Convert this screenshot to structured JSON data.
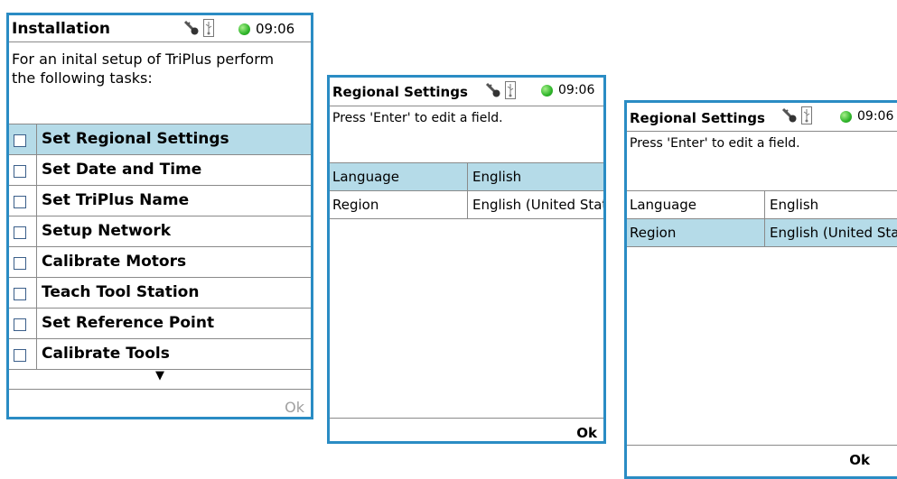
{
  "screens": [
    {
      "title": "Installation",
      "time": "09:06",
      "description": "For an inital setup of TriPlus perform\nthe following tasks:",
      "tasks": [
        {
          "label": "Set Regional Settings",
          "selected": true
        },
        {
          "label": "Set Date and Time",
          "selected": false
        },
        {
          "label": "Set TriPlus Name",
          "selected": false
        },
        {
          "label": "Setup Network",
          "selected": false
        },
        {
          "label": "Calibrate Motors",
          "selected": false
        },
        {
          "label": "Teach Tool Station",
          "selected": false
        },
        {
          "label": "Set Reference Point",
          "selected": false
        },
        {
          "label": "Calibrate Tools",
          "selected": false
        }
      ],
      "more_indicator": "▼",
      "ok_label": "Ok",
      "ok_enabled": false
    },
    {
      "title": "Regional Settings",
      "time": "09:06",
      "description": "Press 'Enter' to edit a field.",
      "fields": [
        {
          "name": "Language",
          "value": "English",
          "selected": true
        },
        {
          "name": "Region",
          "value": "English (United States)",
          "selected": false
        }
      ],
      "ok_label": "Ok",
      "ok_enabled": true
    },
    {
      "title": "Regional Settings",
      "time": "09:06",
      "description": "Press 'Enter' to edit a field.",
      "fields": [
        {
          "name": "Language",
          "value": "English",
          "selected": false
        },
        {
          "name": "Region",
          "value": "English (United States)",
          "selected": true
        }
      ],
      "ok_label": "Ok",
      "ok_enabled": true
    }
  ],
  "colors": {
    "frame_border": "#2a8cc4",
    "selection": "#b5dbe8",
    "status_led": "#2fb52a",
    "disabled_text": "#a0a0a0"
  },
  "icons": [
    "key-icon",
    "usb-icon",
    "status-led-icon",
    "checkbox-icon",
    "down-arrow-icon"
  ]
}
